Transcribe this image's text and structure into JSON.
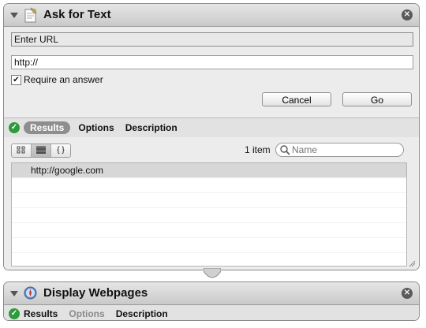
{
  "action1": {
    "title": "Ask for Text",
    "prompt_value": "Enter URL",
    "default_value": "http://",
    "require_answer_label": "Require an answer",
    "require_answer_checked": true,
    "cancel_label": "Cancel",
    "go_label": "Go",
    "tabs": [
      "Results",
      "Options",
      "Description"
    ],
    "selected_tab": "Results",
    "item_count": "1 item",
    "search_placeholder": "Name",
    "results": [
      "http://google.com"
    ],
    "view_options": [
      "icon-view",
      "list-view",
      "code-view"
    ],
    "code_view_glyph": "{ }"
  },
  "action2": {
    "title": "Display Webpages",
    "tabs": [
      "Results",
      "Options",
      "Description"
    ],
    "disabled_tab": "Options"
  },
  "colors": {
    "status_ok": "#2d9b3a",
    "selected_tab_bg": "#8e8e8e",
    "card_bg": "#ececec"
  }
}
